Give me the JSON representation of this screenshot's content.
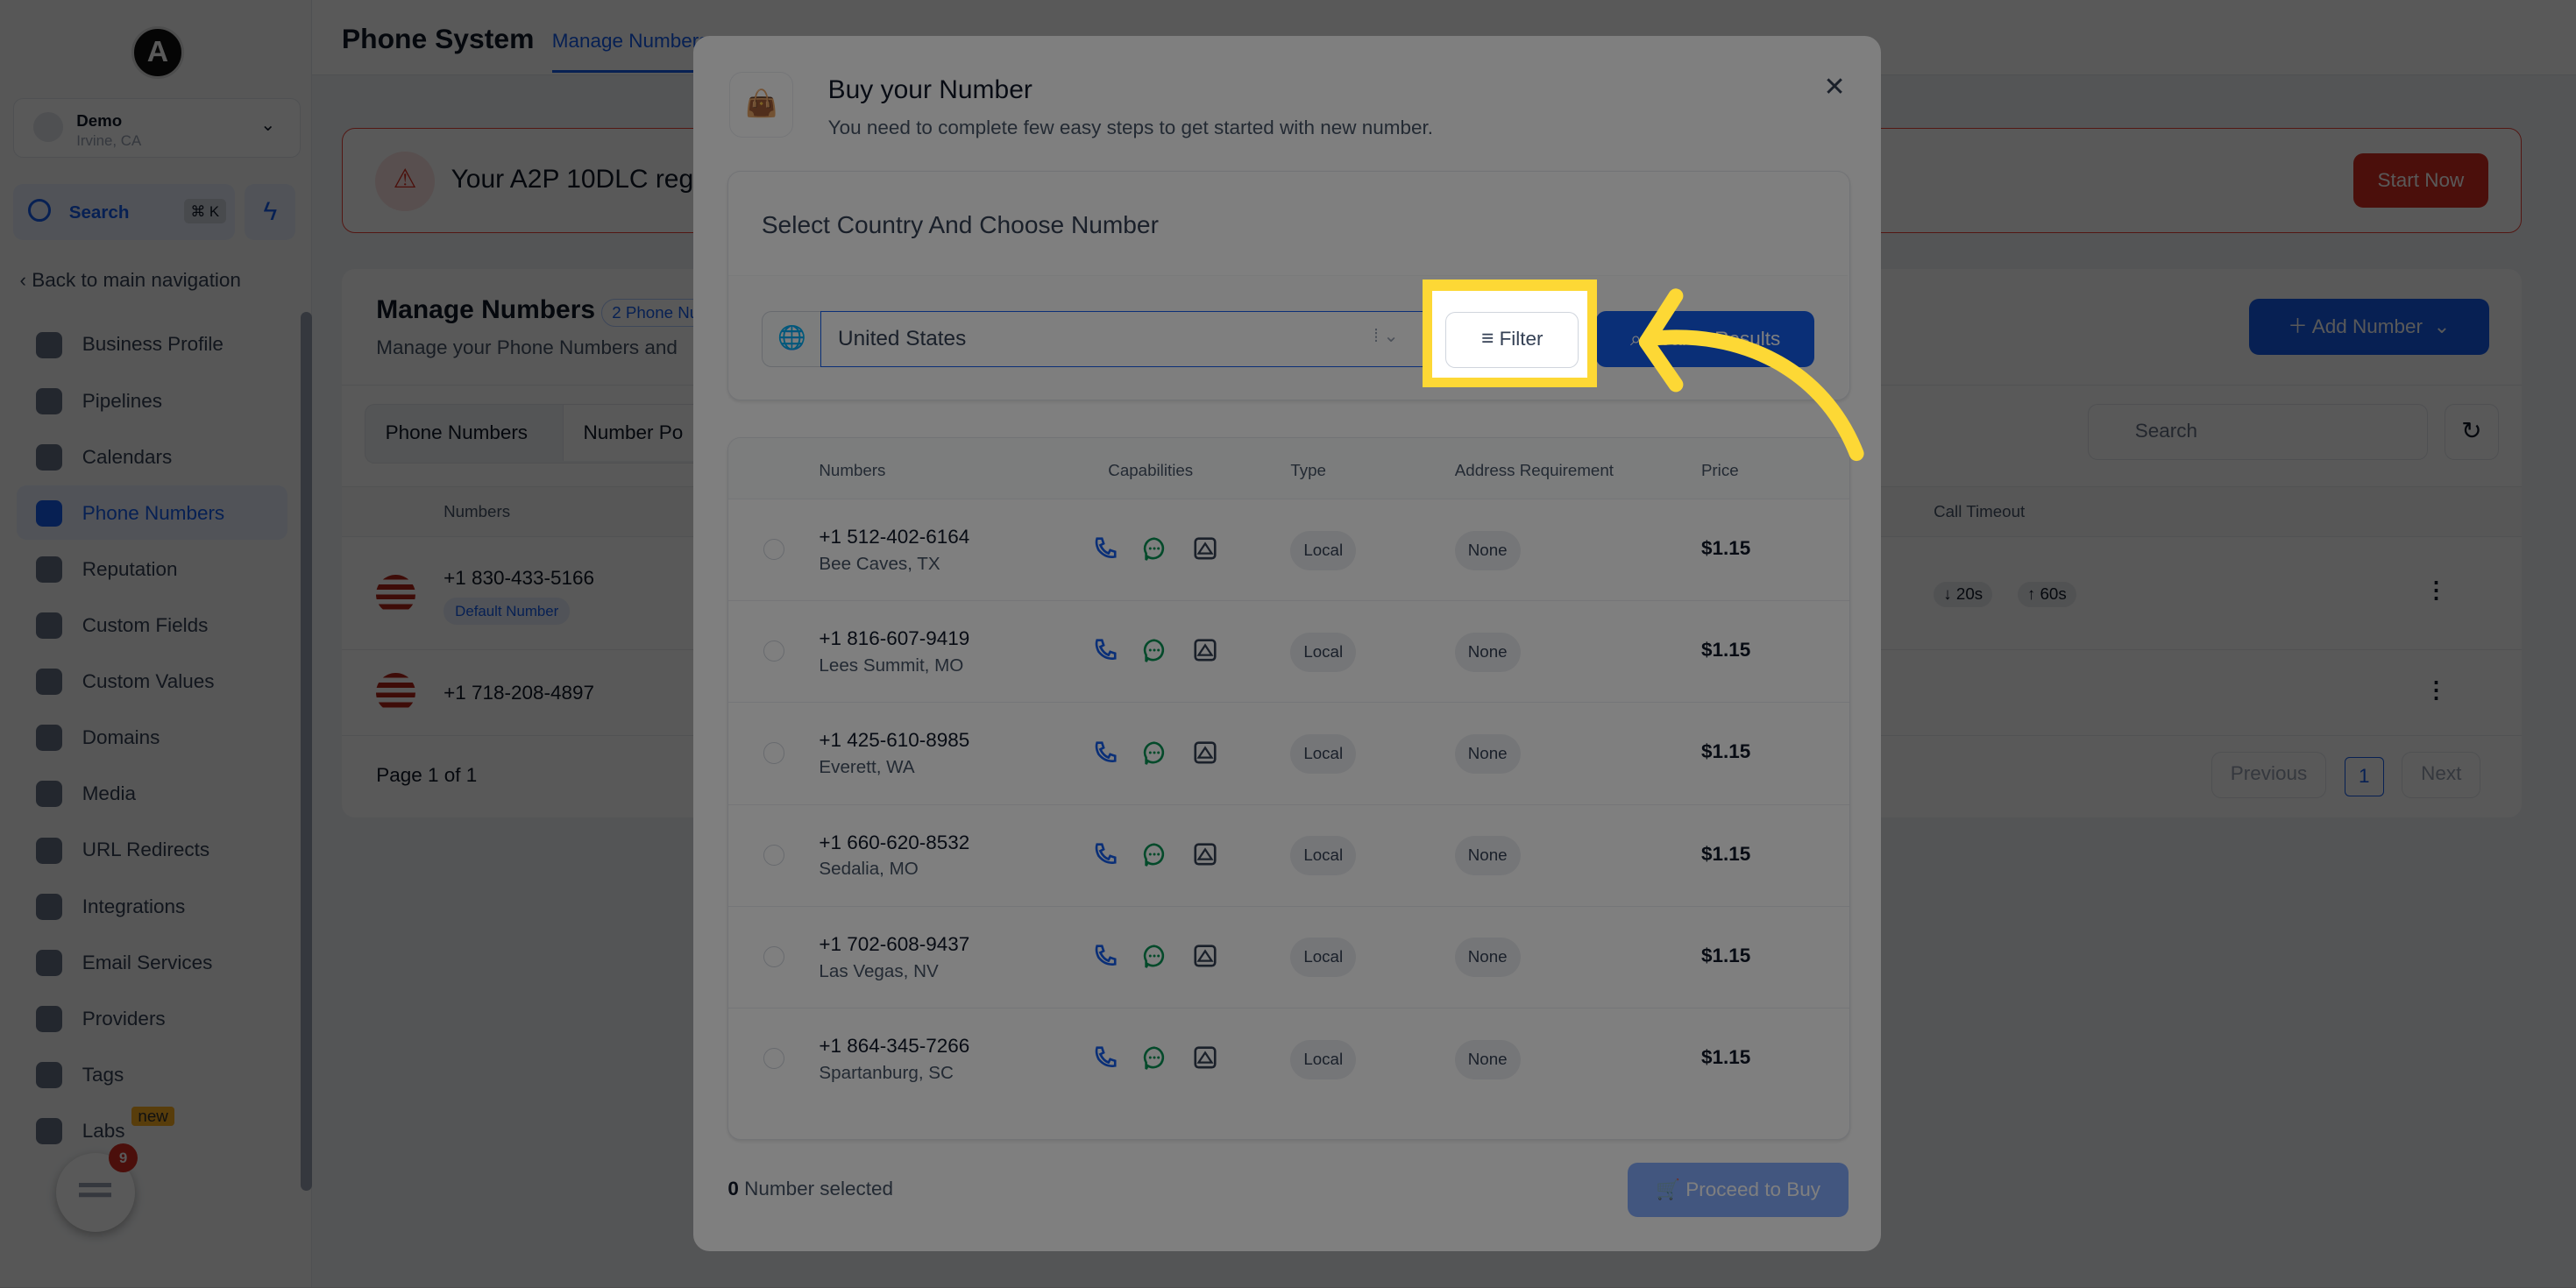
{
  "sidebar": {
    "logo": "A",
    "location": {
      "name": "Demo",
      "city": "Irvine, CA"
    },
    "search": {
      "label": "Search",
      "shortcut": "⌘ K"
    },
    "back": "Back to main navigation",
    "items": [
      {
        "label": "Business Profile"
      },
      {
        "label": "Pipelines"
      },
      {
        "label": "Calendars"
      },
      {
        "label": "Phone Numbers",
        "active": true
      },
      {
        "label": "Reputation"
      },
      {
        "label": "Custom Fields"
      },
      {
        "label": "Custom Values"
      },
      {
        "label": "Domains"
      },
      {
        "label": "Media"
      },
      {
        "label": "URL Redirects"
      },
      {
        "label": "Integrations"
      },
      {
        "label": "Email Services"
      },
      {
        "label": "Providers"
      },
      {
        "label": "Tags"
      },
      {
        "label": "Labs",
        "badge": "new"
      }
    ],
    "chat_badge": "9"
  },
  "header": {
    "title": "Phone System",
    "tabs": [
      {
        "label": "Manage Numbers",
        "active": true
      }
    ]
  },
  "banner": {
    "text": "Your A2P 10DLC reg",
    "button": "Start Now"
  },
  "manage": {
    "title": "Manage Numbers",
    "badge": "2 Phone Nu",
    "subtitle": "Manage your Phone Numbers and",
    "add_button": "Add Number",
    "tabs": [
      "Phone Numbers",
      "Number Po"
    ],
    "search_placeholder": "Search",
    "columns": [
      "Numbers",
      "Call Timeout"
    ],
    "rows": [
      {
        "number": "+1 830-433-5166",
        "badge": "Default Number",
        "timeout_in": "20s",
        "timeout_out": "60s"
      },
      {
        "number": "+1 718-208-4897"
      }
    ],
    "page_text": "Page 1 of 1",
    "previous": "Previous",
    "page": "1",
    "next": "Next"
  },
  "modal": {
    "title": "Buy your Number",
    "subtitle": "You need to complete few easy steps to get started with new number.",
    "section_title": "Select Country And Choose Number",
    "country": "United States",
    "filter": "Filter",
    "search_results": "Search Results",
    "columns": [
      "Numbers",
      "Capabilities",
      "Type",
      "Address Requirement",
      "Price"
    ],
    "rows": [
      {
        "number": "+1 512-402-6164",
        "city": "Bee Caves, TX",
        "type": "Local",
        "address": "None",
        "price": "$1.15"
      },
      {
        "number": "+1 816-607-9419",
        "city": "Lees Summit, MO",
        "type": "Local",
        "address": "None",
        "price": "$1.15"
      },
      {
        "number": "+1 425-610-8985",
        "city": "Everett, WA",
        "type": "Local",
        "address": "None",
        "price": "$1.15"
      },
      {
        "number": "+1 660-620-8532",
        "city": "Sedalia, MO",
        "type": "Local",
        "address": "None",
        "price": "$1.15"
      },
      {
        "number": "+1 702-608-9437",
        "city": "Las Vegas, NV",
        "type": "Local",
        "address": "None",
        "price": "$1.15"
      },
      {
        "number": "+1 864-345-7266",
        "city": "Spartanburg, SC",
        "type": "Local",
        "address": "None",
        "price": "$1.15"
      }
    ],
    "selected_count": "0",
    "selected_label": "Number selected",
    "proceed": "Proceed to Buy"
  },
  "colors": {
    "accent": "#155eef",
    "highlight": "#fdd835",
    "danger": "#d92d20"
  }
}
